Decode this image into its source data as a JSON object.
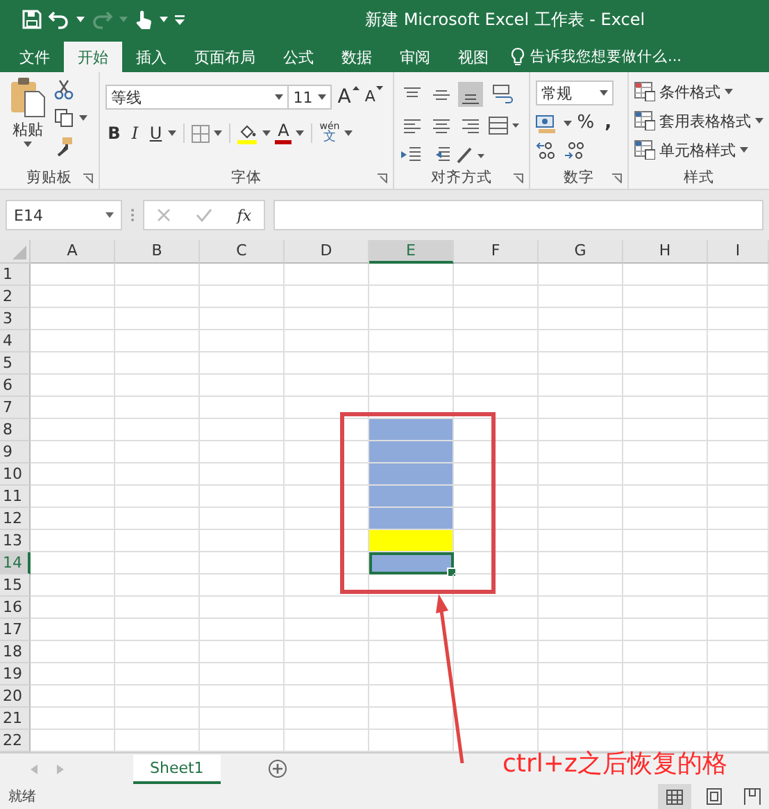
{
  "window": {
    "title": "新建 Microsoft Excel 工作表 - Excel"
  },
  "tabs": [
    {
      "label": "文件",
      "selected": false
    },
    {
      "label": "开始",
      "selected": true
    },
    {
      "label": "插入",
      "selected": false
    },
    {
      "label": "页面布局",
      "selected": false
    },
    {
      "label": "公式",
      "selected": false
    },
    {
      "label": "数据",
      "selected": false
    },
    {
      "label": "审阅",
      "selected": false
    },
    {
      "label": "视图",
      "selected": false
    }
  ],
  "tell_me": {
    "placeholder": "告诉我您想要做什么..."
  },
  "clipboard": {
    "label": "剪贴板",
    "paste": "粘贴"
  },
  "font": {
    "label": "字体",
    "font_name": "等线",
    "font_size": "11",
    "grow": "A",
    "shrink": "A",
    "bold": "B",
    "italic": "I",
    "underline": "U",
    "font_color_letter": "A",
    "phonetic": "文",
    "phonetic_ruby": "wén"
  },
  "alignment": {
    "label": "对齐方式"
  },
  "number": {
    "label": "数字",
    "format": "常规",
    "percent": "%",
    "comma": ","
  },
  "styles": {
    "label": "样式",
    "buttons": [
      "条件格式",
      "套用表格格式",
      "单元格样式"
    ]
  },
  "name_box": {
    "value": "E14"
  },
  "formula_bar": {
    "function_label": "fx"
  },
  "columns": [
    {
      "label": "A",
      "selected": false
    },
    {
      "label": "B",
      "selected": false
    },
    {
      "label": "C",
      "selected": false
    },
    {
      "label": "D",
      "selected": false
    },
    {
      "label": "E",
      "selected": true
    },
    {
      "label": "F",
      "selected": false
    },
    {
      "label": "G",
      "selected": false
    },
    {
      "label": "H",
      "selected": false
    },
    {
      "label": "I",
      "selected": false
    }
  ],
  "rows": [
    {
      "label": "1",
      "selected": false,
      "cells": [
        {
          "selected": false
        },
        {
          "selected": false
        },
        {
          "selected": false
        },
        {
          "selected": false
        },
        {
          "selected": false
        },
        {
          "selected": false
        },
        {
          "selected": false
        },
        {
          "selected": false
        },
        {
          "selected": false
        }
      ]
    },
    {
      "label": "2",
      "selected": false,
      "cells": [
        {
          "selected": false
        },
        {
          "selected": false
        },
        {
          "selected": false
        },
        {
          "selected": false
        },
        {
          "selected": false
        },
        {
          "selected": false
        },
        {
          "selected": false
        },
        {
          "selected": false
        },
        {
          "selected": false
        }
      ]
    },
    {
      "label": "3",
      "selected": false,
      "cells": [
        {
          "selected": false
        },
        {
          "selected": false
        },
        {
          "selected": false
        },
        {
          "selected": false
        },
        {
          "selected": false
        },
        {
          "selected": false
        },
        {
          "selected": false
        },
        {
          "selected": false
        },
        {
          "selected": false
        }
      ]
    },
    {
      "label": "4",
      "selected": false,
      "cells": [
        {
          "selected": false
        },
        {
          "selected": false
        },
        {
          "selected": false
        },
        {
          "selected": false
        },
        {
          "selected": false
        },
        {
          "selected": false
        },
        {
          "selected": false
        },
        {
          "selected": false
        },
        {
          "selected": false
        }
      ]
    },
    {
      "label": "5",
      "selected": false,
      "cells": [
        {
          "selected": false
        },
        {
          "selected": false
        },
        {
          "selected": false
        },
        {
          "selected": false
        },
        {
          "selected": false
        },
        {
          "selected": false
        },
        {
          "selected": false
        },
        {
          "selected": false
        },
        {
          "selected": false
        }
      ]
    },
    {
      "label": "6",
      "selected": false,
      "cells": [
        {
          "selected": false
        },
        {
          "selected": false
        },
        {
          "selected": false
        },
        {
          "selected": false
        },
        {
          "selected": false
        },
        {
          "selected": false
        },
        {
          "selected": false
        },
        {
          "selected": false
        },
        {
          "selected": false
        }
      ]
    },
    {
      "label": "7",
      "selected": false,
      "cells": [
        {
          "selected": false
        },
        {
          "selected": false
        },
        {
          "selected": false
        },
        {
          "selected": false
        },
        {
          "selected": false
        },
        {
          "selected": false
        },
        {
          "selected": false
        },
        {
          "selected": false
        },
        {
          "selected": false
        }
      ]
    },
    {
      "label": "8",
      "selected": false,
      "cells": [
        {
          "selected": false
        },
        {
          "selected": false
        },
        {
          "selected": false
        },
        {
          "selected": false
        },
        {
          "selected": false,
          "color": "#8eaadb"
        },
        {
          "selected": false
        },
        {
          "selected": false
        },
        {
          "selected": false
        },
        {
          "selected": false
        }
      ]
    },
    {
      "label": "9",
      "selected": false,
      "cells": [
        {
          "selected": false
        },
        {
          "selected": false
        },
        {
          "selected": false
        },
        {
          "selected": false
        },
        {
          "selected": false,
          "color": "#8eaadb"
        },
        {
          "selected": false
        },
        {
          "selected": false
        },
        {
          "selected": false
        },
        {
          "selected": false
        }
      ]
    },
    {
      "label": "10",
      "selected": false,
      "cells": [
        {
          "selected": false
        },
        {
          "selected": false
        },
        {
          "selected": false
        },
        {
          "selected": false
        },
        {
          "selected": false,
          "color": "#8eaadb"
        },
        {
          "selected": false
        },
        {
          "selected": false
        },
        {
          "selected": false
        },
        {
          "selected": false
        }
      ]
    },
    {
      "label": "11",
      "selected": false,
      "cells": [
        {
          "selected": false
        },
        {
          "selected": false
        },
        {
          "selected": false
        },
        {
          "selected": false
        },
        {
          "selected": false,
          "color": "#8eaadb"
        },
        {
          "selected": false
        },
        {
          "selected": false
        },
        {
          "selected": false
        },
        {
          "selected": false
        }
      ]
    },
    {
      "label": "12",
      "selected": false,
      "cells": [
        {
          "selected": false
        },
        {
          "selected": false
        },
        {
          "selected": false
        },
        {
          "selected": false
        },
        {
          "selected": false,
          "color": "#8eaadb"
        },
        {
          "selected": false
        },
        {
          "selected": false
        },
        {
          "selected": false
        },
        {
          "selected": false
        }
      ]
    },
    {
      "label": "13",
      "selected": false,
      "cells": [
        {
          "selected": false
        },
        {
          "selected": false
        },
        {
          "selected": false
        },
        {
          "selected": false
        },
        {
          "selected": false,
          "color": "#ffff00"
        },
        {
          "selected": false
        },
        {
          "selected": false
        },
        {
          "selected": false
        },
        {
          "selected": false
        }
      ]
    },
    {
      "label": "14",
      "selected": true,
      "cells": [
        {
          "selected": false
        },
        {
          "selected": false
        },
        {
          "selected": false
        },
        {
          "selected": false
        },
        {
          "selected": true,
          "color": "#8eaadb"
        },
        {
          "selected": false
        },
        {
          "selected": false
        },
        {
          "selected": false
        },
        {
          "selected": false
        }
      ]
    },
    {
      "label": "15",
      "selected": false,
      "cells": [
        {
          "selected": false
        },
        {
          "selected": false
        },
        {
          "selected": false
        },
        {
          "selected": false
        },
        {
          "selected": false
        },
        {
          "selected": false
        },
        {
          "selected": false
        },
        {
          "selected": false
        },
        {
          "selected": false
        }
      ]
    },
    {
      "label": "16",
      "selected": false,
      "cells": [
        {
          "selected": false
        },
        {
          "selected": false
        },
        {
          "selected": false
        },
        {
          "selected": false
        },
        {
          "selected": false
        },
        {
          "selected": false
        },
        {
          "selected": false
        },
        {
          "selected": false
        },
        {
          "selected": false
        }
      ]
    },
    {
      "label": "17",
      "selected": false,
      "cells": [
        {
          "selected": false
        },
        {
          "selected": false
        },
        {
          "selected": false
        },
        {
          "selected": false
        },
        {
          "selected": false
        },
        {
          "selected": false
        },
        {
          "selected": false
        },
        {
          "selected": false
        },
        {
          "selected": false
        }
      ]
    },
    {
      "label": "18",
      "selected": false,
      "cells": [
        {
          "selected": false
        },
        {
          "selected": false
        },
        {
          "selected": false
        },
        {
          "selected": false
        },
        {
          "selected": false
        },
        {
          "selected": false
        },
        {
          "selected": false
        },
        {
          "selected": false
        },
        {
          "selected": false
        }
      ]
    },
    {
      "label": "19",
      "selected": false,
      "cells": [
        {
          "selected": false
        },
        {
          "selected": false
        },
        {
          "selected": false
        },
        {
          "selected": false
        },
        {
          "selected": false
        },
        {
          "selected": false
        },
        {
          "selected": false
        },
        {
          "selected": false
        },
        {
          "selected": false
        }
      ]
    },
    {
      "label": "20",
      "selected": false,
      "cells": [
        {
          "selected": false
        },
        {
          "selected": false
        },
        {
          "selected": false
        },
        {
          "selected": false
        },
        {
          "selected": false
        },
        {
          "selected": false
        },
        {
          "selected": false
        },
        {
          "selected": false
        },
        {
          "selected": false
        }
      ]
    },
    {
      "label": "21",
      "selected": false,
      "cells": [
        {
          "selected": false
        },
        {
          "selected": false
        },
        {
          "selected": false
        },
        {
          "selected": false
        },
        {
          "selected": false
        },
        {
          "selected": false
        },
        {
          "selected": false
        },
        {
          "selected": false
        },
        {
          "selected": false
        }
      ]
    },
    {
      "label": "22",
      "selected": false,
      "cells": [
        {
          "selected": false
        },
        {
          "selected": false
        },
        {
          "selected": false
        },
        {
          "selected": false
        },
        {
          "selected": false
        },
        {
          "selected": false
        },
        {
          "selected": false
        },
        {
          "selected": false
        },
        {
          "selected": false
        }
      ]
    }
  ],
  "sheet_tabs": [
    {
      "label": "Sheet1",
      "selected": true
    }
  ],
  "status_bar": {
    "text": "就绪"
  },
  "view_buttons": [
    {
      "kind": "normal",
      "selected": true
    },
    {
      "kind": "page_layout",
      "selected": false
    },
    {
      "kind": "page_break",
      "selected": false
    }
  ],
  "annotation": {
    "text": "ctrl+z之后恢复的格"
  }
}
